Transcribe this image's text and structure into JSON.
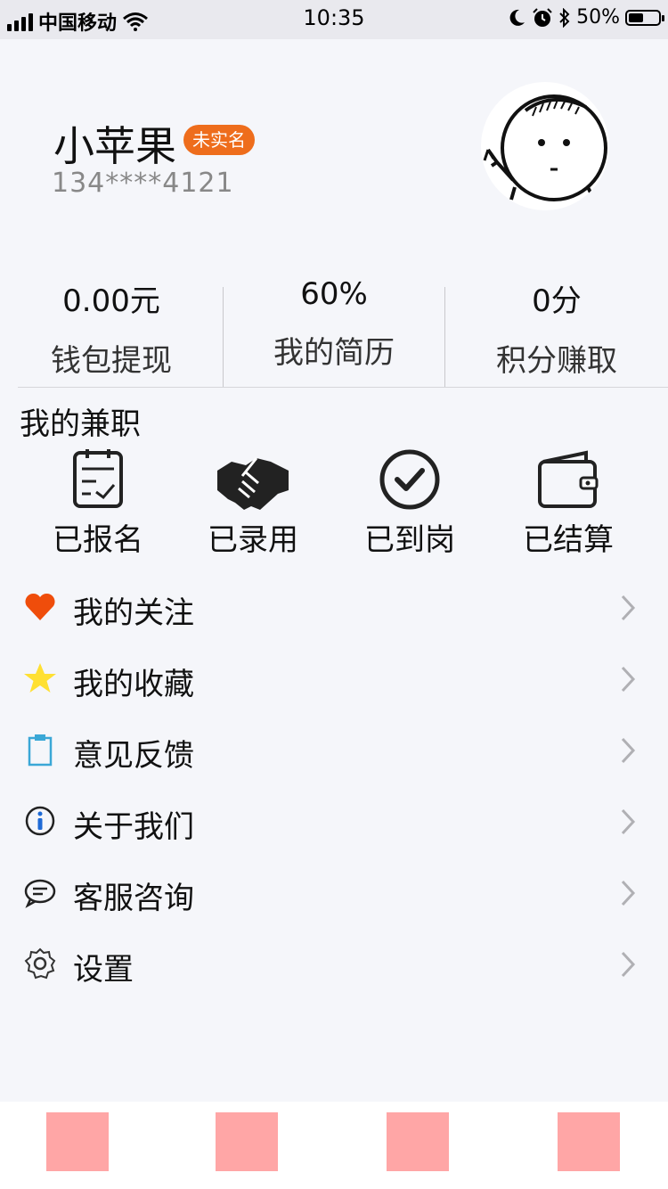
{
  "status_bar": {
    "carrier": "中国移动",
    "time": "10:35",
    "battery_text": "50%",
    "battery_level": 0.5
  },
  "profile": {
    "name": "小苹果",
    "badge": "未实名",
    "phone": "134****4121",
    "badge_color": "#ee6d1c"
  },
  "stats": [
    {
      "value": "0.00元",
      "label": "钱包提现"
    },
    {
      "value": "60%",
      "label": "我的简历"
    },
    {
      "value": "0分",
      "label": "积分赚取"
    }
  ],
  "parttime": {
    "title": "我的兼职",
    "items": [
      {
        "label": "已报名",
        "icon": "clipboard-check-icon"
      },
      {
        "label": "已录用",
        "icon": "handshake-icon"
      },
      {
        "label": "已到岗",
        "icon": "check-circle-icon"
      },
      {
        "label": "已结算",
        "icon": "wallet-icon"
      }
    ]
  },
  "menu": [
    {
      "label": "我的关注",
      "icon": "heart-icon"
    },
    {
      "label": "我的收藏",
      "icon": "star-icon"
    },
    {
      "label": "意见反馈",
      "icon": "clipboard-icon"
    },
    {
      "label": "关于我们",
      "icon": "info-icon"
    },
    {
      "label": "客服咨询",
      "icon": "chat-bubble-icon"
    },
    {
      "label": "设置",
      "icon": "gear-icon"
    }
  ],
  "colors": {
    "accent": "#ee6d1c",
    "heart": "#ef4d0b",
    "star": "#ffe033",
    "tab_placeholder": "#ffa6a6"
  }
}
